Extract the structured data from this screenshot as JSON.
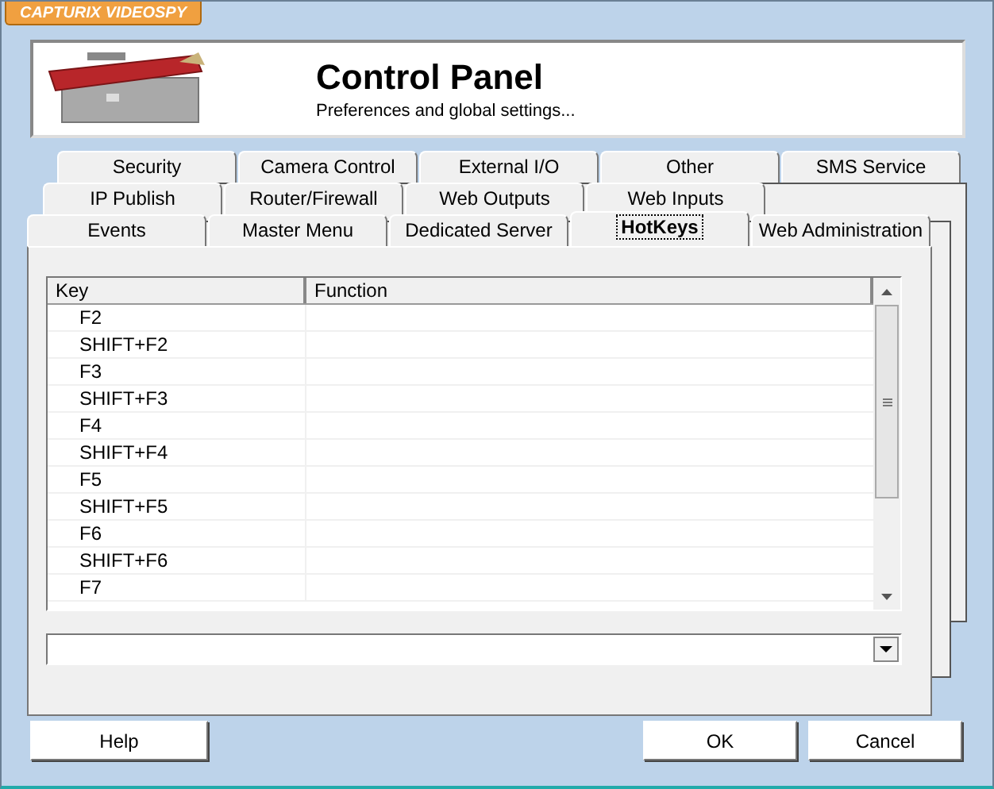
{
  "app_badge": "CAPTURIX VIDEOSPY",
  "header": {
    "title": "Control Panel",
    "subtitle": "Preferences and global settings..."
  },
  "tab_rows": [
    [
      {
        "label": "Security",
        "selected": false
      },
      {
        "label": "Camera Control",
        "selected": false
      },
      {
        "label": "External I/O",
        "selected": false
      },
      {
        "label": "Other",
        "selected": false
      },
      {
        "label": "SMS Service",
        "selected": false
      }
    ],
    [
      {
        "label": "IP Publish",
        "selected": false
      },
      {
        "label": "Router/Firewall",
        "selected": false
      },
      {
        "label": "Web Outputs",
        "selected": false
      },
      {
        "label": "Web Inputs",
        "selected": false
      }
    ],
    [
      {
        "label": "Events",
        "selected": false
      },
      {
        "label": "Master Menu",
        "selected": false
      },
      {
        "label": "Dedicated Server",
        "selected": false
      },
      {
        "label": "HotKeys",
        "selected": true
      },
      {
        "label": "Web Administration",
        "selected": false
      }
    ]
  ],
  "table": {
    "columns": [
      "Key",
      "Function"
    ],
    "rows": [
      "F2",
      "SHIFT+F2",
      "F3",
      "SHIFT+F3",
      "F4",
      "SHIFT+F4",
      "F5",
      "SHIFT+F5",
      "F6",
      "SHIFT+F6",
      "F7"
    ]
  },
  "buttons": {
    "left": [
      "Help"
    ],
    "right": [
      "OK",
      "Cancel"
    ]
  }
}
